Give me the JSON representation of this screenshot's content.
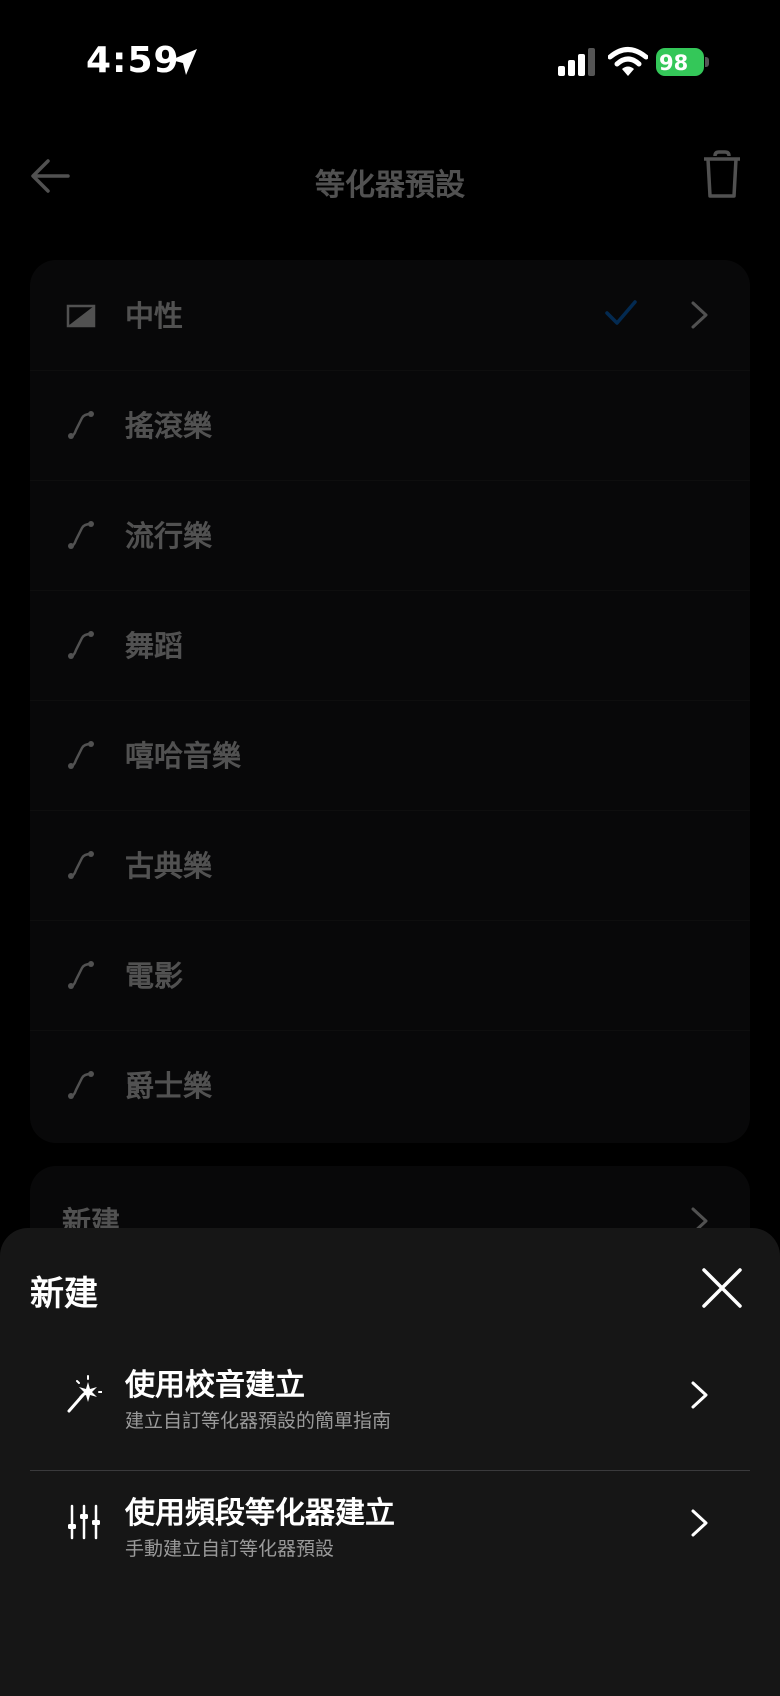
{
  "status": {
    "time": "4:59",
    "battery": "98"
  },
  "nav": {
    "title": "等化器預設",
    "back_icon": "arrow-left-icon",
    "delete_icon": "trash-icon"
  },
  "presets": {
    "items": [
      {
        "label": "中性",
        "icon": "neutral-preset-icon",
        "selected": true
      },
      {
        "label": "搖滾樂",
        "icon": "curve-icon"
      },
      {
        "label": "流行樂",
        "icon": "curve-icon"
      },
      {
        "label": "舞蹈",
        "icon": "curve-icon"
      },
      {
        "label": "嘻哈音樂",
        "icon": "curve-icon"
      },
      {
        "label": "古典樂",
        "icon": "curve-icon"
      },
      {
        "label": "電影",
        "icon": "curve-icon"
      },
      {
        "label": "爵士樂",
        "icon": "curve-icon"
      }
    ],
    "check_color": "#0a84ff"
  },
  "new_row": {
    "label": "新建"
  },
  "sheet": {
    "title": "新建",
    "close_icon": "close-icon",
    "options": [
      {
        "title": "使用校音建立",
        "subtitle": "建立自訂等化器預設的簡單指南",
        "icon": "magic-wand-icon"
      },
      {
        "title": "使用頻段等化器建立",
        "subtitle": "手動建立自訂等化器預設",
        "icon": "sliders-icon"
      }
    ]
  },
  "colors": {
    "battery": "#34c759",
    "sheet_bg": "#161616",
    "card_bg": "#1c1c1e"
  }
}
